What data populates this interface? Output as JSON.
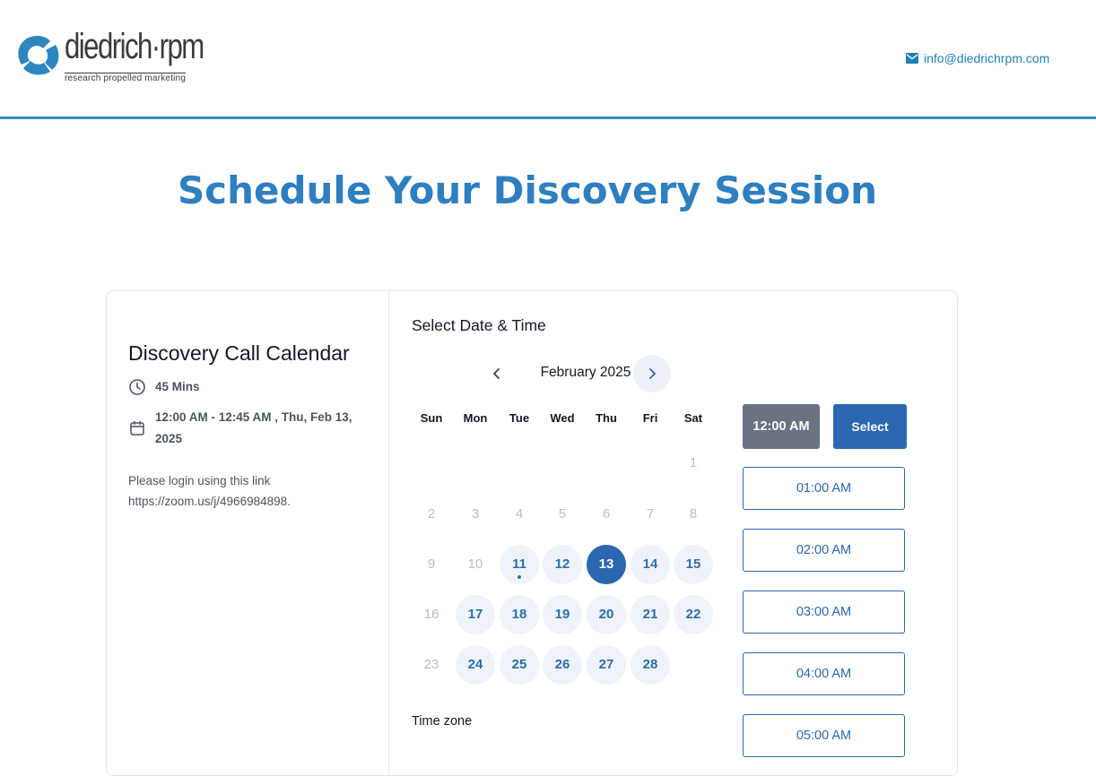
{
  "header": {
    "logo_word": "diedrich·rpm",
    "logo_tagline": "research propelled marketing",
    "email": "info@diedrichrpm.com"
  },
  "page_title": "Schedule Your Discovery Session",
  "event": {
    "name": "Discovery Call Calendar",
    "duration": "45 Mins",
    "datetime": "12:00 AM - 12:45 AM , Thu, Feb 13, 2025",
    "description_line1": "Please login using this link",
    "description_line2": "https://zoom.us/j/4966984898."
  },
  "calendar": {
    "section_title": "Select Date & Time",
    "month_label": "February 2025",
    "weekdays": [
      "Sun",
      "Mon",
      "Tue",
      "Wed",
      "Thu",
      "Fri",
      "Sat"
    ],
    "weeks": [
      [
        null,
        null,
        null,
        null,
        null,
        null,
        {
          "d": "1",
          "s": "dis"
        }
      ],
      [
        {
          "d": "2",
          "s": "dis"
        },
        {
          "d": "3",
          "s": "dis"
        },
        {
          "d": "4",
          "s": "dis"
        },
        {
          "d": "5",
          "s": "dis"
        },
        {
          "d": "6",
          "s": "dis"
        },
        {
          "d": "7",
          "s": "dis"
        },
        {
          "d": "8",
          "s": "dis"
        }
      ],
      [
        {
          "d": "9",
          "s": "dis"
        },
        {
          "d": "10",
          "s": "dis"
        },
        {
          "d": "11",
          "s": "av",
          "today": true
        },
        {
          "d": "12",
          "s": "av"
        },
        {
          "d": "13",
          "s": "sel"
        },
        {
          "d": "14",
          "s": "av"
        },
        {
          "d": "15",
          "s": "av"
        }
      ],
      [
        {
          "d": "16",
          "s": "dis"
        },
        {
          "d": "17",
          "s": "av"
        },
        {
          "d": "18",
          "s": "av"
        },
        {
          "d": "19",
          "s": "av"
        },
        {
          "d": "20",
          "s": "av"
        },
        {
          "d": "21",
          "s": "av"
        },
        {
          "d": "22",
          "s": "av"
        }
      ],
      [
        {
          "d": "23",
          "s": "dis"
        },
        {
          "d": "24",
          "s": "av"
        },
        {
          "d": "25",
          "s": "av"
        },
        {
          "d": "26",
          "s": "av"
        },
        {
          "d": "27",
          "s": "av"
        },
        {
          "d": "28",
          "s": "av"
        },
        null
      ]
    ],
    "timezone_label": "Time zone"
  },
  "slots": {
    "selected_time": "12:00 AM",
    "select_label": "Select",
    "times": [
      "01:00 AM",
      "02:00 AM",
      "03:00 AM",
      "04:00 AM",
      "05:00 AM"
    ]
  },
  "colors": {
    "accent": "#2b67b1",
    "title_blue": "#2e7fc0",
    "header_rule": "#2f8fc2",
    "selected_slot_gray": "#6b7280"
  },
  "icons": {
    "email": "envelope-icon",
    "duration": "clock-icon",
    "datetime": "calendar-icon",
    "prev": "chevron-left-icon",
    "next": "chevron-right-icon"
  }
}
